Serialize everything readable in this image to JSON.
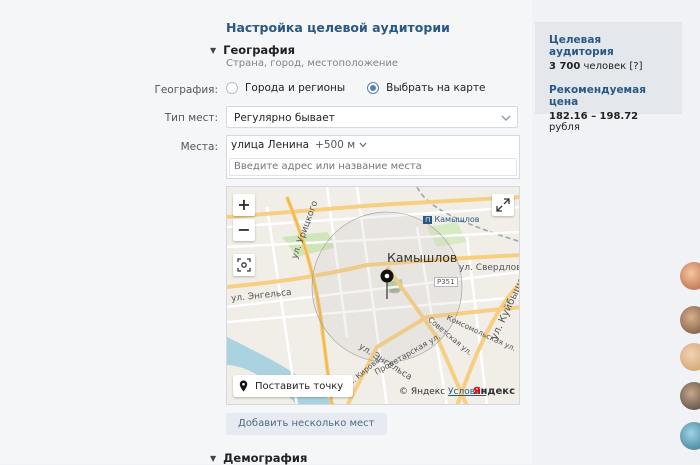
{
  "header": {
    "title": "Настройка целевой аудитории"
  },
  "geography": {
    "title": "География",
    "subtitle": "Страна, город, местоположение",
    "label": "География:",
    "options": [
      "Города и регионы",
      "Выбрать на карте"
    ],
    "selected_option": "Выбрать на карте",
    "place_type_label": "Тип мест:",
    "place_type_value": "Регулярно бывает",
    "places_label": "Места:",
    "place_chip": "улица Ленина",
    "place_radius": "+500 м",
    "place_input_placeholder": "Введите адрес или название места"
  },
  "map": {
    "city": "Камышлов",
    "streets": {
      "uritskogo": "ул. Урицкого",
      "engelsa1": "ул. Энгельса",
      "engelsa2": "ул. Энгельса",
      "sverdlova": "ул. Свердлова",
      "kuibysheva": "ул. Куйбышева",
      "komsomolskaya": "Комсомольская ул.",
      "sovetskaya": "Советская ул.",
      "proletarskaya": "Пролетарская ул.",
      "kirova": "ул. Кирова"
    },
    "station": "Камышлов",
    "road_badge": "Р351",
    "zoom_in": "+",
    "zoom_out": "−",
    "put_point": "Поставить точку",
    "copyright_prefix": "© Яндекс",
    "copyright_link": "Условия",
    "logo_first": "Я",
    "logo_rest": "ндекс"
  },
  "add_places_button": "Добавить несколько мест",
  "demography": {
    "title": "Демография"
  },
  "audience": {
    "title": "Целевая аудитория",
    "count": "3 700",
    "unit": "человек",
    "help": "[?]",
    "price_title": "Рекомендуемая цена",
    "price_range": "182.16 – 198.72",
    "price_unit": "рубля"
  },
  "colors": {
    "link": "#2a5885",
    "accent": "#5181b8"
  }
}
